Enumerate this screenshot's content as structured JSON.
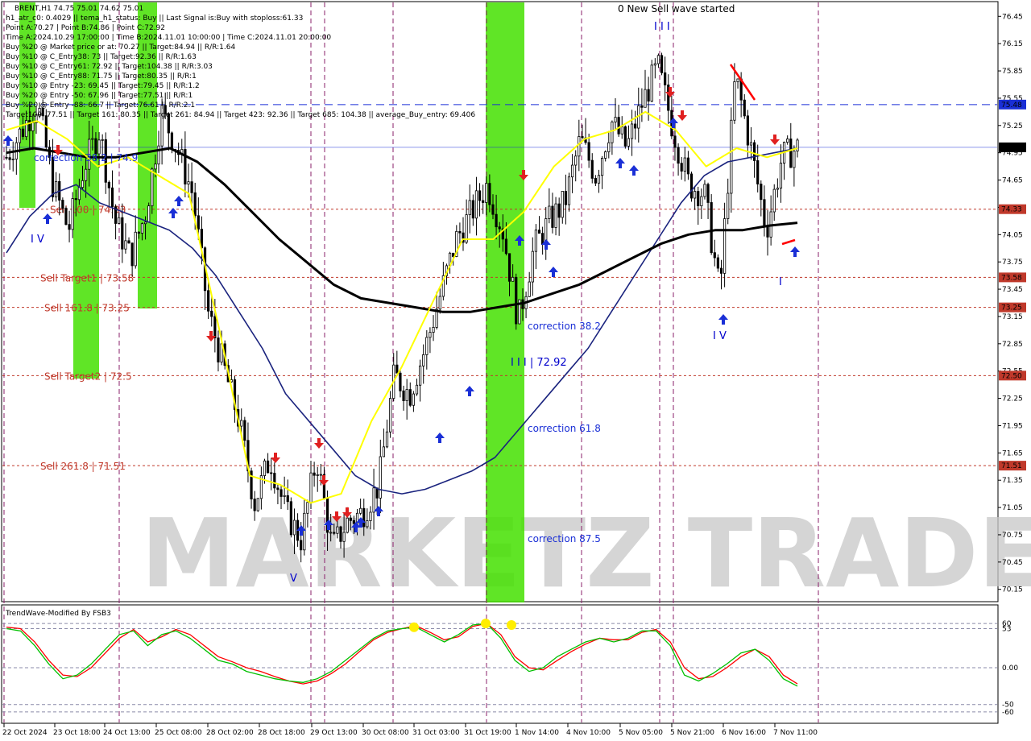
{
  "header": {
    "lines": [
      "BRENT,H1  74.75 75.01 74.62 75.01",
      "h1_atr_c0: 0.4029 || tema_h1_status: Buy || Last Signal is:Buy with stoploss:61.33",
      "Point A:70.27 | Point B:74.86 | Point C:72.92",
      "Time A:2024.10.29 17:00:00 | Time B:2024.11.01 10:00:00 | Time C:2024.11.01 20:00:00",
      "Buy %20 @ Market price or at: 70.27 || Target:84.94 || R/R:1.64",
      "Buy %10 @ C_Entry38: 73 || Target:92.36 || R/R:1.63",
      "Buy %10 @ C_Entry61: 72.92 || Target:104.38 || R/R:3.03",
      "Buy %10 @ C_Entry88: 71.75 || Target:80.35 || R/R:1",
      "Buy %10 @ Entry -23: 69.45 || Target:79.45 || R/R:1.2",
      "Buy %20 @ Entry -50: 67.96 || Target:77.51 || R/R:1",
      "Buy %20 @ Entry -88: 66.7 || Target:76.61 || R/R:2.1",
      "Target100: 77.51 || Target 161: 80.35 || Target 261: 84.94 || Target 423: 92.36 || Target 685: 104.38 || average_Buy_entry: 69.406"
    ]
  },
  "status_text": "0 New Sell wave started",
  "indicator_title": "TrendWave-Modified By FSB3",
  "watermark": "MARKETZ TRADE",
  "price_axis": {
    "ticks": [
      "76.45",
      "76.15",
      "75.85",
      "75.55",
      "75.25",
      "74.95",
      "74.65",
      "74.35",
      "74.05",
      "73.75",
      "73.45",
      "73.15",
      "72.85",
      "72.55",
      "72.25",
      "71.95",
      "71.65",
      "71.35",
      "71.05",
      "70.75",
      "70.45",
      "70.15"
    ],
    "badges": [
      {
        "label": "75.48",
        "value": 75.48,
        "color": "#1a2fd6"
      },
      {
        "label": "75.01",
        "value": 75.01,
        "color": "#000000"
      },
      {
        "label": "74.33",
        "value": 74.33,
        "color": "#c0392b"
      },
      {
        "label": "73.58",
        "value": 73.58,
        "color": "#c0392b"
      },
      {
        "label": "73.25",
        "value": 73.25,
        "color": "#c0392b"
      },
      {
        "label": "72.50",
        "value": 72.5,
        "color": "#c0392b"
      },
      {
        "label": "71.51",
        "value": 71.51,
        "color": "#c0392b"
      }
    ]
  },
  "indicator_axis": {
    "ticks": [
      "60",
      "53",
      "0.00",
      "-50",
      "-60"
    ]
  },
  "time_axis": {
    "labels": [
      "22 Oct 2024",
      "23 Oct 18:00",
      "24 Oct 13:00",
      "25 Oct 08:00",
      "28 Oct 02:00",
      "28 Oct 18:00",
      "29 Oct 13:00",
      "30 Oct 08:00",
      "31 Oct 03:00",
      "31 Oct 19:00",
      "1 Nov 14:00",
      "4 Nov 10:00",
      "5 Nov 05:00",
      "5 Nov 21:00",
      "6 Nov 16:00",
      "7 Nov 11:00"
    ]
  },
  "levels": [
    {
      "label": "",
      "value": 75.48,
      "color": "#1a2fd6"
    },
    {
      "label": "",
      "value": 75.01,
      "color": "#1a2fd6"
    },
    {
      "label": "Sell 100 | 74.33",
      "value": 74.33,
      "color": "#c0392b"
    },
    {
      "label": "Sell Target1 | 73.58",
      "value": 73.58,
      "color": "#c0392b"
    },
    {
      "label": "Sell 161.8 | 73.25",
      "value": 73.25,
      "color": "#c0392b"
    },
    {
      "label": "Sell Target2 | 72.5",
      "value": 72.5,
      "color": "#c0392b"
    },
    {
      "label": "Sell  261.8 | 71.51",
      "value": 71.51,
      "color": "#c0392b"
    }
  ],
  "annotations": {
    "correction_382": "correction 38.2",
    "correction_618": "correction 61.8",
    "correction_875": "correction 87.5",
    "wave_c_label": "I I I | 72.92",
    "wave_iii_top": "I I I",
    "wave_iv_right": "I V",
    "wave_iv_left": "I V",
    "wave_v": "V",
    "wave_i": "I",
    "correction_left": "correction 38.2 | 74.9"
  },
  "chart_data": {
    "type": "candlestick",
    "title": "BRENT,H1",
    "ylim": [
      70.05,
      76.55
    ],
    "y_scale_labels": "price",
    "x": [
      "22 Oct 2024",
      "23 Oct 18:00",
      "24 Oct 13:00",
      "25 Oct 08:00",
      "28 Oct 02:00",
      "28 Oct 18:00",
      "29 Oct 13:00",
      "30 Oct 08:00",
      "31 Oct 03:00",
      "31 Oct 19:00",
      "1 Nov 14:00",
      "4 Nov 10:00",
      "5 Nov 05:00",
      "5 Nov 21:00",
      "6 Nov 16:00",
      "7 Nov 11:00"
    ],
    "close_path": [
      74.9,
      75.2,
      75.5,
      74.6,
      74.1,
      74.8,
      75.2,
      74.2,
      73.8,
      74.3,
      75.4,
      75.0,
      74.5,
      73.2,
      72.6,
      72.0,
      71.1,
      71.6,
      71.0,
      70.7,
      71.6,
      70.6,
      70.9,
      71.0,
      71.3,
      72.5,
      72.3,
      72.8,
      73.4,
      74.0,
      74.3,
      74.6,
      74.1,
      73.1,
      73.9,
      74.2,
      74.4,
      75.1,
      74.7,
      75.3,
      75.0,
      75.5,
      75.9,
      75.2,
      74.6,
      74.5,
      73.4,
      75.8,
      75.0,
      74.1,
      74.9,
      75.0
    ],
    "series": [
      {
        "name": "",
        "color": "#1a237e",
        "values": [
          73.85,
          74.25,
          74.5,
          74.6,
          74.4,
          74.3,
          74.2,
          74.1,
          73.9,
          73.6,
          73.2,
          72.8,
          72.3,
          72.0,
          71.7,
          71.4,
          71.25,
          71.2,
          71.25,
          71.35,
          71.45,
          71.6,
          71.9,
          72.2,
          72.5,
          72.8,
          73.2,
          73.6,
          74.0,
          74.4,
          74.7,
          74.85,
          74.9,
          74.95,
          75.0
        ],
        "color_name": "navy-ma"
      },
      {
        "name": "",
        "color": "#000000",
        "values": [
          74.95,
          75.0,
          74.95,
          74.9,
          74.9,
          74.95,
          75.0,
          74.85,
          74.6,
          74.3,
          74.0,
          73.75,
          73.5,
          73.35,
          73.3,
          73.25,
          73.2,
          73.2,
          73.25,
          73.3,
          73.4,
          73.5,
          73.65,
          73.8,
          73.95,
          74.05,
          74.1,
          74.1,
          74.15,
          74.18
        ],
        "color_name": "black-ma"
      },
      {
        "name": "",
        "color": "#ffff00",
        "values": [
          75.2,
          75.3,
          75.1,
          74.8,
          74.9,
          74.7,
          74.5,
          73.0,
          71.4,
          71.3,
          71.1,
          71.2,
          72.0,
          72.6,
          73.3,
          74.0,
          74.0,
          74.3,
          74.8,
          75.1,
          75.2,
          75.4,
          75.2,
          74.8,
          75.0,
          74.9,
          75.0
        ],
        "color_name": "yellow-line"
      }
    ],
    "indicator": {
      "name": "TrendWave-Modified By FSB3",
      "ylim": [
        -70,
        70
      ],
      "levels": [
        60,
        53,
        0,
        -50,
        -60
      ],
      "green": [
        53,
        50,
        30,
        5,
        -15,
        -10,
        5,
        25,
        45,
        50,
        30,
        45,
        50,
        40,
        25,
        10,
        5,
        -5,
        -10,
        -15,
        -18,
        -20,
        -15,
        -5,
        10,
        25,
        40,
        50,
        53,
        55,
        45,
        35,
        45,
        58,
        60,
        40,
        10,
        -5,
        0,
        15,
        25,
        35,
        40,
        35,
        40,
        50,
        50,
        30,
        -10,
        -18,
        -8,
        5,
        20,
        25,
        10,
        -15,
        -25
      ],
      "red": [
        55,
        53,
        35,
        10,
        -10,
        -12,
        0,
        20,
        40,
        52,
        35,
        42,
        52,
        45,
        30,
        15,
        8,
        0,
        -5,
        -12,
        -18,
        -22,
        -18,
        -8,
        5,
        22,
        38,
        48,
        53,
        57,
        48,
        38,
        42,
        56,
        60,
        45,
        15,
        0,
        -3,
        10,
        22,
        32,
        40,
        38,
        38,
        48,
        52,
        35,
        0,
        -15,
        -12,
        0,
        15,
        25,
        15,
        -10,
        -22
      ],
      "signal_dots_value": [
        55,
        60,
        58
      ]
    }
  },
  "colors": {
    "up_candle": "#000000",
    "down_candle": "#000000",
    "buy_arrow": "#1a2fd6",
    "sell_arrow": "#e02020",
    "green_zone": "#44e000",
    "grid_dash": "#8a1f6a",
    "badge_red": "#c0392b",
    "badge_blue": "#1a2fd6"
  }
}
